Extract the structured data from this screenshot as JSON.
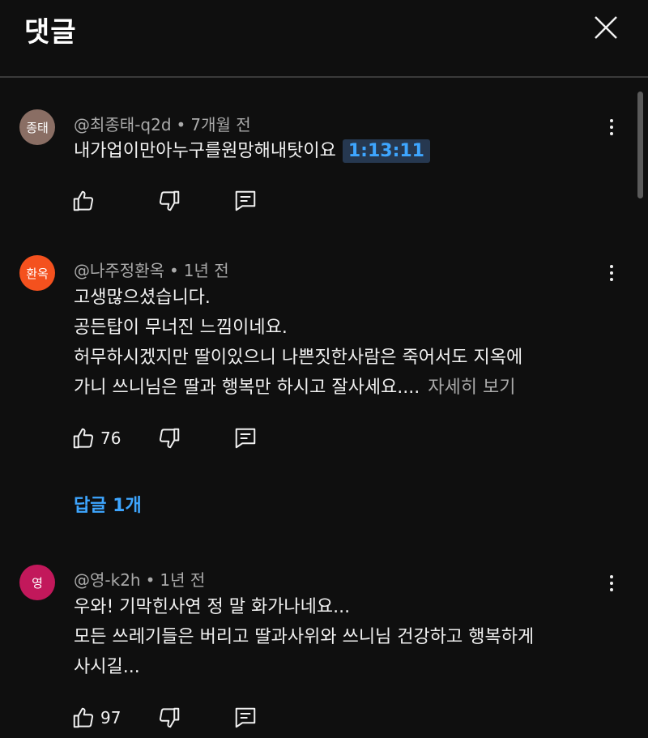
{
  "header": {
    "title": "댓글",
    "close_icon": "close-icon"
  },
  "colors": {
    "background": "#0f0f0f",
    "link": "#3ea6ff",
    "muted": "#aaaaaa"
  },
  "comments": [
    {
      "avatar_text": "종태",
      "avatar_color": "#8a6e64",
      "author": "@최종태-q2d",
      "time": "7개월 전",
      "lines": [
        "내가업이만아누구를원망해내탓이요"
      ],
      "timestamp": "1:13:11",
      "likes": ""
    },
    {
      "avatar_text": "환옥",
      "avatar_color": "#f4511e",
      "author": "@나주정환옥",
      "time": "1년 전",
      "lines": [
        "고생많으셨습니다.",
        "공든탑이 무너진 느낌이네요.",
        "허무하시겠지만  딸이있으니  나쁜짓한사람은  죽어서도 지옥에",
        "가니  쓰니님은  딸과 행복만 하시고 잘사세요...."
      ],
      "more": "자세히 보기",
      "likes": "76",
      "replies": "답글 1개"
    },
    {
      "avatar_text": "영",
      "avatar_color": "#c2185b",
      "author": "@영-k2h",
      "time": "1년 전",
      "lines": [
        "우와! 기막힌사연  정 말 화가나네요...",
        "모든 쓰레기들은  버리고  딸과사위와 쓰니님  건강하고 행복하게",
        "사시길..."
      ],
      "likes": "97"
    }
  ]
}
